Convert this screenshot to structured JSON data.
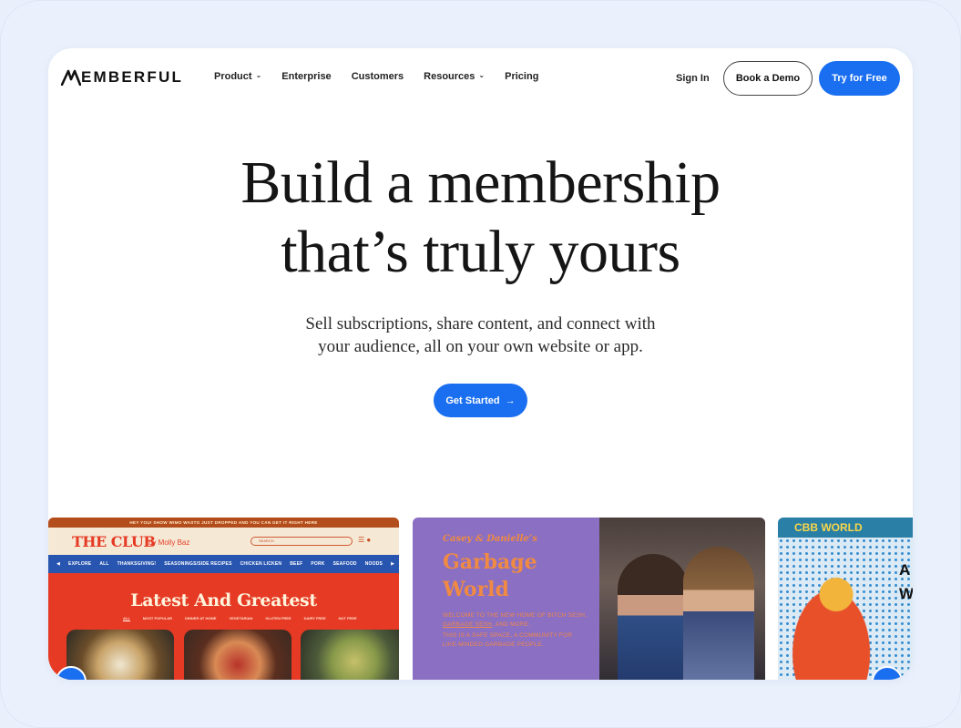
{
  "brand": {
    "logo_text": "EMBERFUL",
    "logo_icon": "memberful-m-logo",
    "accent": "#1a6ff0"
  },
  "nav": {
    "links": [
      {
        "label": "Product",
        "has_dropdown": true
      },
      {
        "label": "Enterprise",
        "has_dropdown": false
      },
      {
        "label": "Customers",
        "has_dropdown": false
      },
      {
        "label": "Resources",
        "has_dropdown": true
      },
      {
        "label": "Pricing",
        "has_dropdown": false
      }
    ],
    "sign_in": "Sign In",
    "book_demo": "Book a Demo",
    "try_free": "Try for Free"
  },
  "hero": {
    "title_line1": "Build a membership",
    "title_line2": "that’s truly yours",
    "subtitle_line1": "Sell subscriptions, share content, and connect with",
    "subtitle_line2": "your audience, all on your own website or app.",
    "cta": "Get Started",
    "cta_icon": "arrow-right-icon"
  },
  "showcase": {
    "card1": {
      "topbar": "HEY YOU! SHOW WIMO WASTO JUST DROPPED AND YOU CAN GET IT RIGHT HERE",
      "logo": "THE CLUB",
      "byline": "by Molly Baz",
      "search_placeholder": "SEARCH",
      "categories": [
        "EXPLORE",
        "ALL",
        "THANKSGIVING!",
        "SEASONINGS/SIDE RECIPES",
        "CHICKEN LICKEN",
        "BEEF",
        "PORK",
        "SEAFOOD",
        "NOODS"
      ],
      "heading": "Latest And Greatest",
      "tabs": [
        "ALL",
        "MOST POPULAR",
        "DINNER AT HOME",
        "VEGETARIAN",
        "GLUTEN FREE",
        "DAIRY FREE",
        "NUT FREE"
      ]
    },
    "card2": {
      "script": "Casey & Danielle’s",
      "title_line1": "Garbage",
      "title_line2": "World",
      "text1_a": "WELCOME TO THE NEW HOME OF BITCH SESH, ",
      "text1_link": "GARBAGE SESH",
      "text1_b": ", AND MORE.",
      "text2": "THIS IS A SAFE SPACE, A COMMUNITY FOR LIKE-MINDED GARBAGE PEOPLE."
    },
    "card3": {
      "title": "CBB WORLD",
      "letters": [
        "A",
        "W"
      ]
    }
  }
}
